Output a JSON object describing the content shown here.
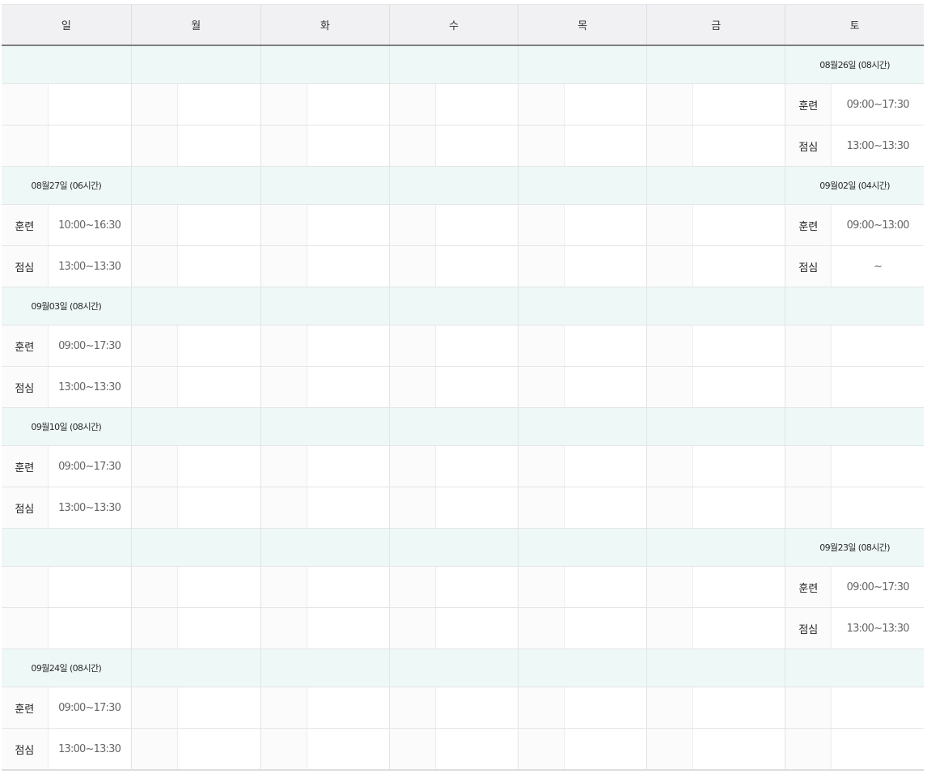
{
  "days": [
    "일",
    "월",
    "화",
    "수",
    "목",
    "금",
    "토"
  ],
  "slot_labels": {
    "train": "훈련",
    "lunch": "점심"
  },
  "weeks": [
    {
      "sat": {
        "date": "08월26일 (08시간)",
        "train": "09:00~17:30",
        "lunch": "13:00~13:30"
      }
    },
    {
      "sun": {
        "date": "08월27일 (06시간)",
        "train": "10:00~16:30",
        "lunch": "13:00~13:30"
      },
      "sat": {
        "date": "09월02일 (04시간)",
        "train": "09:00~13:00",
        "lunch": "~"
      }
    },
    {
      "sun": {
        "date": "09월03일 (08시간)",
        "train": "09:00~17:30",
        "lunch": "13:00~13:30"
      }
    },
    {
      "sun": {
        "date": "09월10일 (08시간)",
        "train": "09:00~17:30",
        "lunch": "13:00~13:30"
      }
    },
    {
      "sat": {
        "date": "09월23일 (08시간)",
        "train": "09:00~17:30",
        "lunch": "13:00~13:30"
      }
    },
    {
      "sun": {
        "date": "09월24일 (08시간)",
        "train": "09:00~17:30",
        "lunch": "13:00~13:30"
      }
    }
  ]
}
